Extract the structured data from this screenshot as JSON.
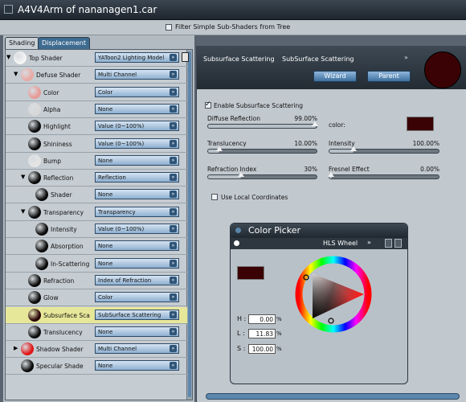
{
  "window": {
    "title": "A4V4Arm of nananagen1.car"
  },
  "toolbar": {
    "filter_label": "Filter Simple Sub-Shaders from Tree"
  },
  "tabs": [
    {
      "label": "Shading"
    },
    {
      "label": "Displacement"
    }
  ],
  "tree": [
    {
      "label": "Top Shader",
      "value": "YAToon2 Lighting Model",
      "ball": "#f4f4f4"
    },
    {
      "label": "Defuse Shader",
      "value": "Multi Channel",
      "ball": "#e9a9a4"
    },
    {
      "label": "Color",
      "value": "Color",
      "ball": "#e69a96"
    },
    {
      "label": "Alpha",
      "value": "None",
      "ball": "#d8d8d8"
    },
    {
      "label": "Highlight",
      "value": "Value (0~100%)",
      "ball": "#0a0a0a"
    },
    {
      "label": "Shininess",
      "value": "Value (0~100%)",
      "ball": "#0a0a0a"
    },
    {
      "label": "Bump",
      "value": "None",
      "ball": "#e4e4e4"
    },
    {
      "label": "Reflection",
      "value": "Reflection",
      "ball": "#0a0a0a"
    },
    {
      "label": "Shader",
      "value": "None",
      "ball": "#0a0a0a"
    },
    {
      "label": "Transparency",
      "value": "Transparency",
      "ball": "#0a0a0a"
    },
    {
      "label": "Intensity",
      "value": "Value (0~100%)",
      "ball": "#0a0a0a"
    },
    {
      "label": "Absorption",
      "value": "None",
      "ball": "#0a0a0a"
    },
    {
      "label": "In-Scattering",
      "value": "None",
      "ball": "#0a0a0a"
    },
    {
      "label": "Refraction",
      "value": "Index of Refraction",
      "ball": "#0a0a0a"
    },
    {
      "label": "Glow",
      "value": "Color",
      "ball": "#0a0a0a"
    },
    {
      "label": "Subsurface Sca",
      "value": "SubSurface Scattering",
      "ball": "#2a0405"
    },
    {
      "label": "Translucency",
      "value": "None",
      "ball": "#0a0a0a"
    },
    {
      "label": "Shadow Shader",
      "value": "Multi Channel",
      "ball": "#e01616"
    },
    {
      "label": "Specular Shade",
      "value": "None",
      "ball": "#0a0a0a"
    }
  ],
  "panel": {
    "header_title": "Subsurface Scattering",
    "header_type": "SubSurface Scattering",
    "wizard_label": "Wizard",
    "parent_label": "Parent",
    "enable_label": "Enable Subsurface Scattering",
    "diffuse_label": "Diffuse Reflection",
    "diffuse_value": "99.00%",
    "color_label": "color:",
    "translucency_label": "Translucency",
    "translucency_value": "10.00%",
    "intensity_label": "Intensity",
    "intensity_value": "100.00%",
    "refraction_label": "Refraction Index",
    "refraction_value": "30%",
    "fresnel_label": "Fresnel Effect",
    "fresnel_value": "0.00%",
    "local_coords_label": "Use Local Coordinates"
  },
  "picker": {
    "title": "Color Picker",
    "mode": "HLS Wheel",
    "h_label": "H :",
    "h_value": "0.00",
    "l_label": "L :",
    "l_value": "11.83",
    "s_label": "S :",
    "s_value": "100.00",
    "pct": "%"
  },
  "colors": {
    "swatch": "#3a0204",
    "accent": "#3e6b90"
  }
}
